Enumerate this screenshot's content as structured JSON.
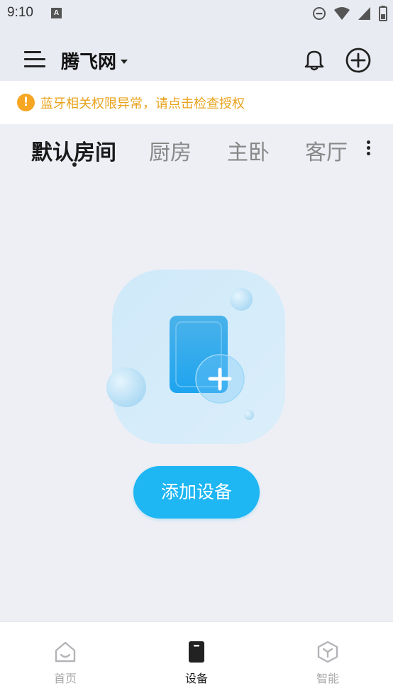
{
  "status_bar": {
    "time": "9:10",
    "notification_letter": "A",
    "icons": [
      "dnd-icon",
      "wifi-icon",
      "signal-icon",
      "battery-icon"
    ]
  },
  "header": {
    "home_name": "腾飞网",
    "icons": [
      "menu-icon",
      "bell-icon",
      "add-circle-icon"
    ]
  },
  "warning": {
    "icon": "!",
    "text": "蓝牙相关权限异常，请点击检查授权",
    "color": "#e8a31d"
  },
  "rooms": {
    "tabs": [
      {
        "label": "默认房间",
        "active": true
      },
      {
        "label": "厨房",
        "active": false
      },
      {
        "label": "主卧",
        "active": false
      },
      {
        "label": "客厅",
        "active": false
      }
    ]
  },
  "empty_state": {
    "add_button_label": "添加设备",
    "accent": "#1eb6f3"
  },
  "bottom_nav": {
    "items": [
      {
        "label": "首页",
        "icon": "home-icon",
        "active": false
      },
      {
        "label": "设备",
        "icon": "device-icon",
        "active": true
      },
      {
        "label": "智能",
        "icon": "smart-cube-icon",
        "active": false
      }
    ]
  }
}
